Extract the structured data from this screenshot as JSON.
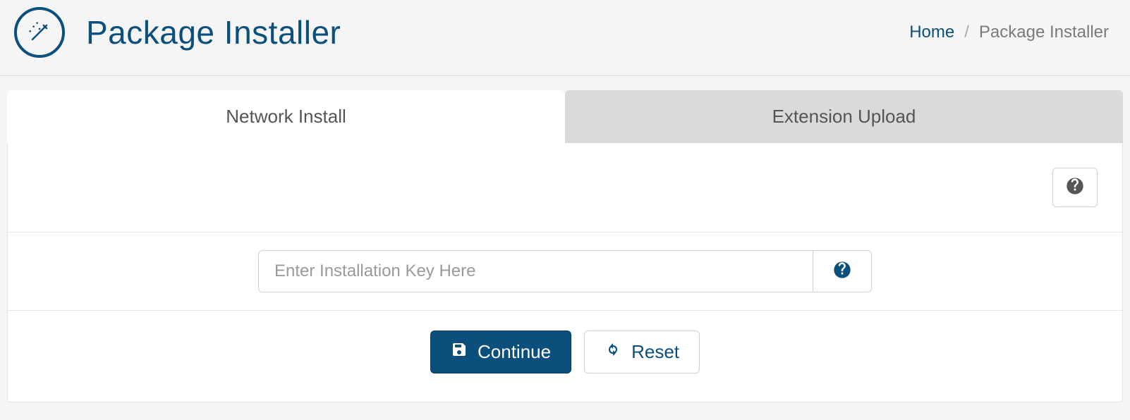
{
  "header": {
    "title": "Package Installer"
  },
  "breadcrumb": {
    "home": "Home",
    "sep": "/",
    "current": "Package Installer"
  },
  "tabs": {
    "network": "Network Install",
    "upload": "Extension Upload"
  },
  "form": {
    "key_placeholder": "Enter Installation Key Here"
  },
  "actions": {
    "continue": "Continue",
    "reset": "Reset"
  }
}
